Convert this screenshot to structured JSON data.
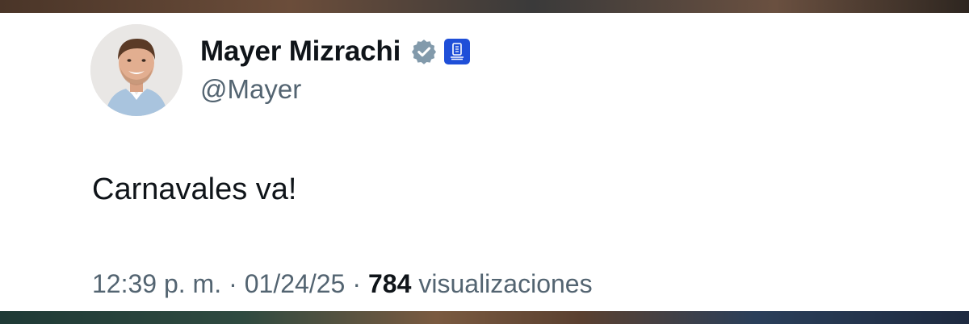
{
  "tweet": {
    "author": {
      "display_name": "Mayer Mizrachi",
      "handle": "@Mayer",
      "verified_color": "#829aab",
      "affiliate_badge_color": "#1f4fd8"
    },
    "text": "Carnavales va!",
    "meta": {
      "time": "12:39 p. m.",
      "separator_1": "·",
      "date": "01/24/25",
      "separator_2": "·",
      "views_count": "784",
      "views_label": "visualizaciones"
    }
  }
}
